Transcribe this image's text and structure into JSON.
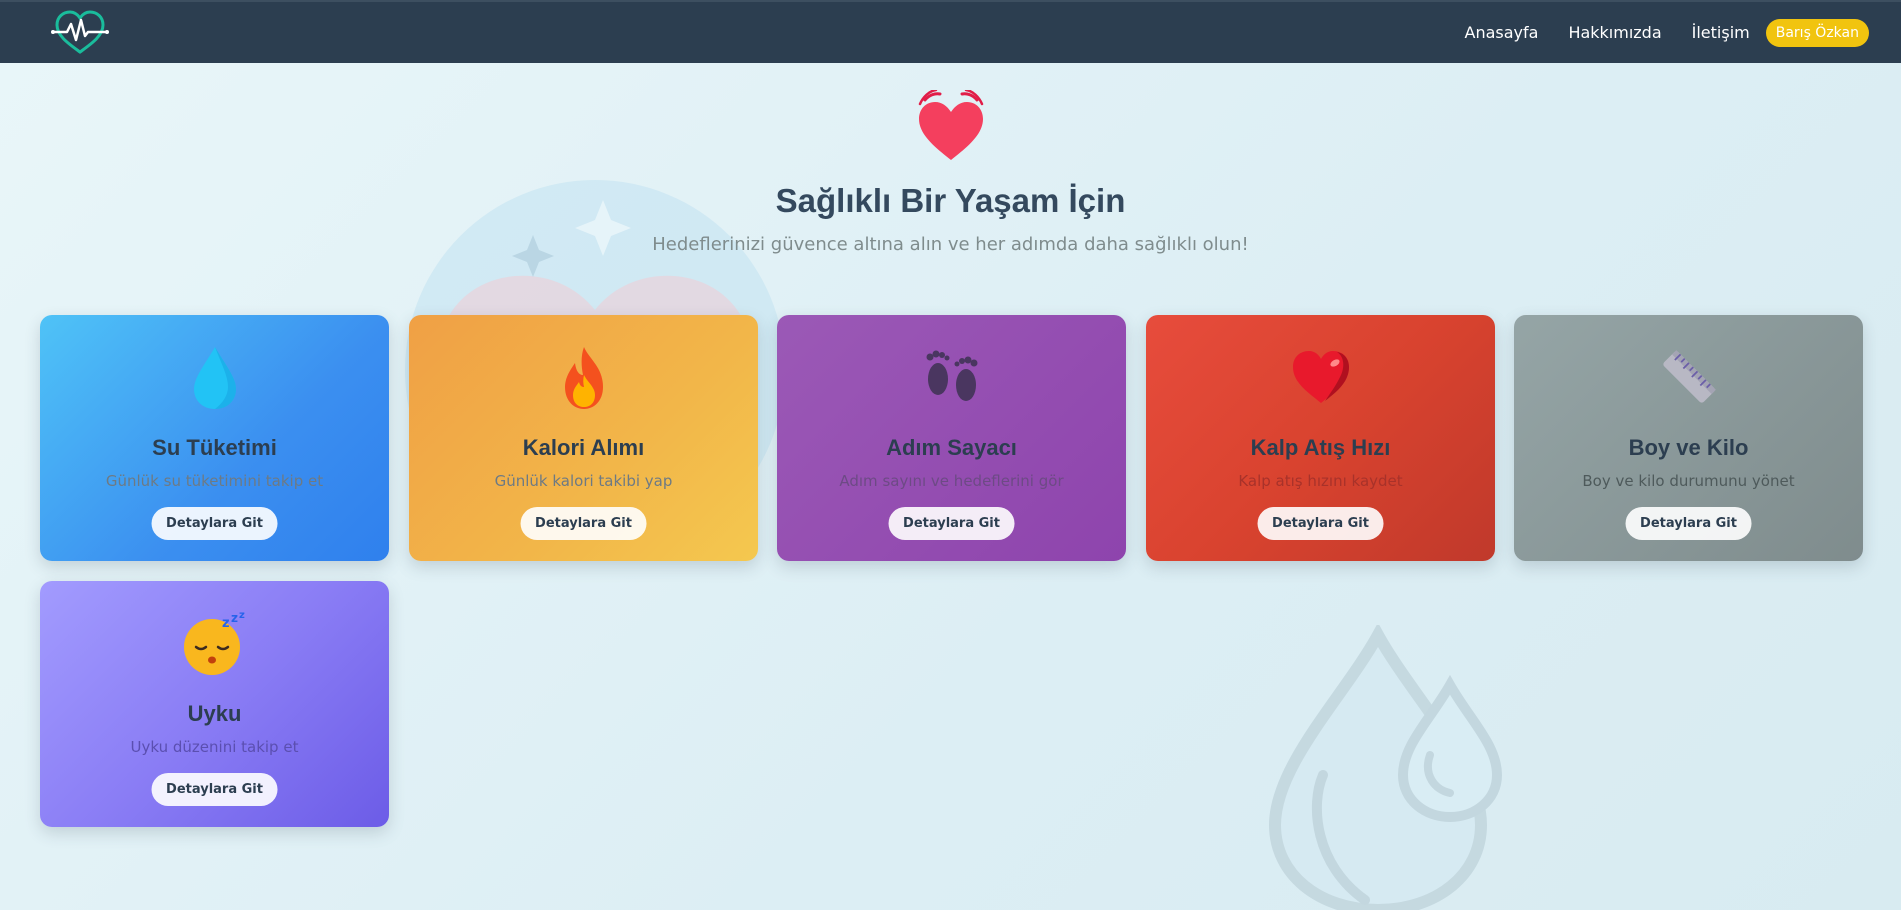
{
  "nav": {
    "logo_icon": "heart-pulse-logo-icon",
    "links": [
      "Anasayfa",
      "Hakkımızda",
      "İletişim"
    ],
    "user_name": "Barış Özkan"
  },
  "hero": {
    "icon": "beating-heart-icon",
    "title": "Sağlıklı Bir Yaşam İçin",
    "subtitle": "Hedeflerinizi güvence altına alın ve her adımda daha sağlıklı olun!"
  },
  "cards": [
    {
      "icon": "water-drop-icon",
      "title": "Su Tüketimi",
      "description": "Günlük su tüketimini takip et",
      "button": "Detaylara Git",
      "color": "#3b8ff0"
    },
    {
      "icon": "fire-icon",
      "title": "Kalori Alımı",
      "description": "Günlük kalori takibi yap",
      "button": "Detaylara Git",
      "color": "#f2b649"
    },
    {
      "icon": "footprints-icon",
      "title": "Adım Sayacı",
      "description": "Adım sayını ve hedeflerini gör",
      "button": "Detaylara Git",
      "color": "#8e44ad"
    },
    {
      "icon": "heart-icon",
      "title": "Kalp Atış Hızı",
      "description": "Kalp atış hızını kaydet",
      "button": "Detaylara Git",
      "color": "#d9432f"
    },
    {
      "icon": "ruler-icon",
      "title": "Boy ve Kilo",
      "description": "Boy ve kilo durumunu yönet",
      "button": "Detaylara Git",
      "color": "#8a9a9b"
    },
    {
      "icon": "sleeping-face-icon",
      "title": "Uyku",
      "description": "Uyku düzenini takip et",
      "button": "Detaylara Git",
      "color": "#8a7df5"
    }
  ],
  "colors": {
    "navbar": "#2c3e50",
    "user_badge": "#f1c40f",
    "title_text": "#34495e"
  }
}
